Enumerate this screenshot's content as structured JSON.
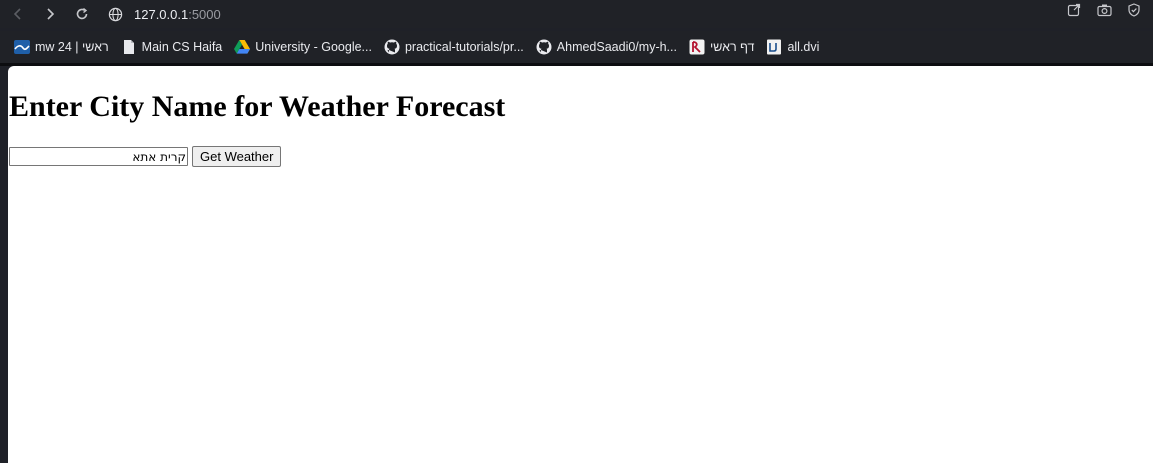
{
  "browser": {
    "address": {
      "host": "127.0.0.1",
      "port": ":5000"
    },
    "bookmarks": [
      {
        "label": "mw 24 | ראשי",
        "icon": "wave-logo-icon"
      },
      {
        "label": "Main CS Haifa",
        "icon": "document-icon"
      },
      {
        "label": "University - Google...",
        "icon": "google-drive-icon"
      },
      {
        "label": "practical-tutorials/pr...",
        "icon": "github-icon"
      },
      {
        "label": "AhmedSaadi0/my-h...",
        "icon": "github-icon"
      },
      {
        "label": "דף ראשי",
        "icon": "site-logo-icon"
      },
      {
        "label": "all.dvi",
        "icon": "pdf-file-icon"
      }
    ]
  },
  "page": {
    "title": "Enter City Name for Weather Forecast",
    "city_input_value": "קרית אתא",
    "submit_label": "Get Weather"
  }
}
